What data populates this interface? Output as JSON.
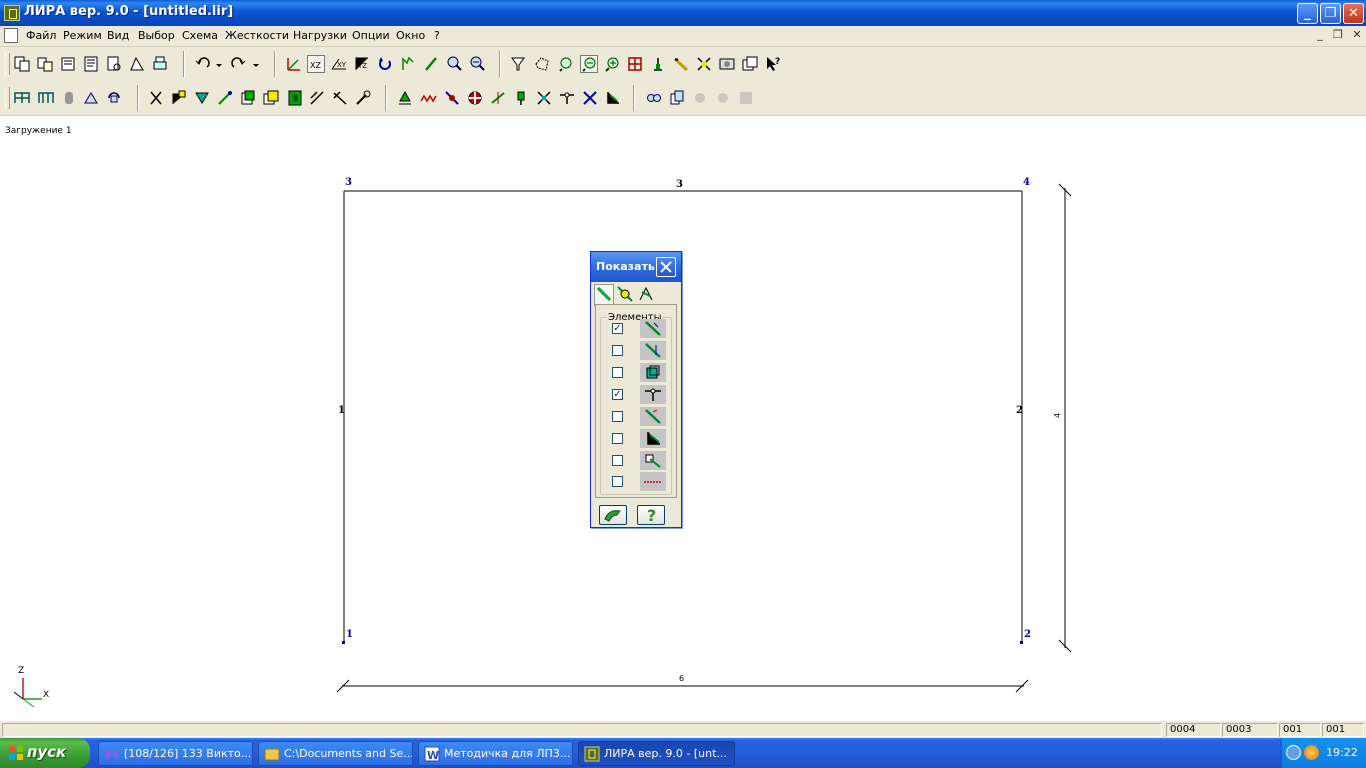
{
  "window": {
    "title": "ЛИРА  вер. 9.0 - [untitled.lir]",
    "minimize_glyph": "_",
    "restore_glyph": "❐",
    "close_glyph": "✕"
  },
  "menu": {
    "items": [
      "Файл",
      "Режим",
      "Вид",
      "Выбор",
      "Схема",
      "Жесткости",
      "Нагрузки",
      "Опции",
      "Окно",
      "?"
    ],
    "mdi_buttons": [
      "_",
      "❐",
      "✕"
    ]
  },
  "canvas": {
    "loadcase_label": "Загружение  1",
    "nodes": [
      "1",
      "2",
      "3",
      "4"
    ],
    "element_labels": {
      "left": "1",
      "right": "2",
      "top": "3"
    },
    "dimension_labels": {
      "horizontal": "6",
      "vertical": "4"
    },
    "axes": {
      "z": "Z",
      "x": "X"
    },
    "colors": {
      "node_label": "#0000aa",
      "line": "#000000",
      "axis_x": "#1a9a1a",
      "axis_z": "#d01010"
    }
  },
  "dialog": {
    "title": "Показать",
    "group_label": "Элементы",
    "elements": [
      {
        "checked": true,
        "icon": "bar-element-icon"
      },
      {
        "checked": false,
        "icon": "bar-end-icon"
      },
      {
        "checked": false,
        "icon": "solid-element-icon"
      },
      {
        "checked": true,
        "icon": "hinge-element-icon"
      },
      {
        "checked": false,
        "icon": "local-axes-icon"
      },
      {
        "checked": false,
        "icon": "rigid-insert-icon"
      },
      {
        "checked": false,
        "icon": "rigid-block-icon"
      },
      {
        "checked": false,
        "icon": "spring-element-icon"
      }
    ],
    "apply_icon": "apply-icon",
    "help_glyph": "?"
  },
  "status": {
    "cells": [
      "0004",
      "0003",
      "001",
      "001"
    ]
  },
  "taskbar": {
    "start_label": "пуск",
    "tasks": [
      {
        "label": "[108/126] 133 Викто...",
        "active": false
      },
      {
        "label": "C:\\Documents and Se...",
        "active": false
      },
      {
        "label": "Методичка для ЛП3...",
        "active": false
      },
      {
        "label": "ЛИРА  вер. 9.0 - [unt...",
        "active": true
      }
    ],
    "clock": "19:22"
  }
}
